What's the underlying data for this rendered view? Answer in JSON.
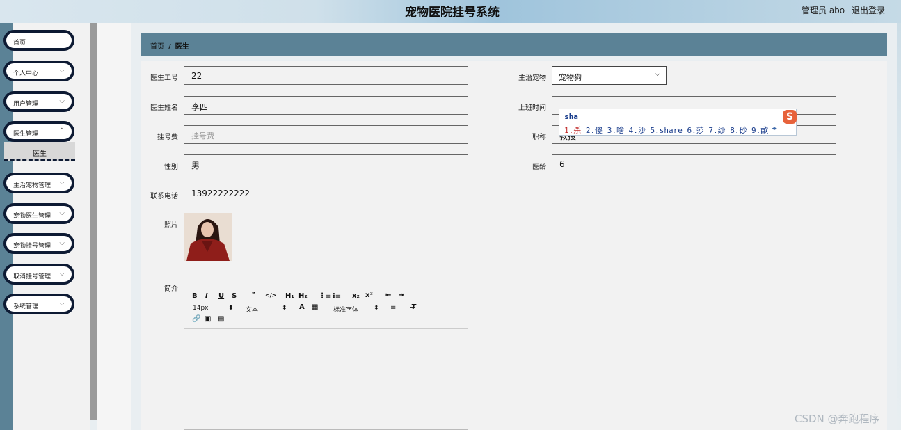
{
  "header": {
    "title": "宠物医院挂号系统",
    "user_label": "管理员 abo",
    "logout_label": "退出登录"
  },
  "sidebar": {
    "items": [
      {
        "label": "首页",
        "has_chevron": false
      },
      {
        "label": "个人中心",
        "has_chevron": true
      },
      {
        "label": "用户管理",
        "has_chevron": true
      },
      {
        "label": "医生管理",
        "has_chevron": true
      },
      {
        "label": "主治宠物管理",
        "has_chevron": true
      },
      {
        "label": "宠物医生管理",
        "has_chevron": true
      },
      {
        "label": "宠物挂号管理",
        "has_chevron": true
      },
      {
        "label": "取消挂号管理",
        "has_chevron": true
      },
      {
        "label": "系统管理",
        "has_chevron": true
      }
    ],
    "submenu_item": "医生"
  },
  "breadcrumb": {
    "home": "首页",
    "separator": "/",
    "current": "医生"
  },
  "form": {
    "doctor_id": {
      "label": "医生工号",
      "value": "22"
    },
    "doctor_name": {
      "label": "医生姓名",
      "value": "李四"
    },
    "fee": {
      "label": "挂号费",
      "value": "",
      "placeholder": "挂号费"
    },
    "gender": {
      "label": "性别",
      "value": "男"
    },
    "phone": {
      "label": "联系电话",
      "value": "13922222222"
    },
    "photo": {
      "label": "照片"
    },
    "intro": {
      "label": "简介"
    },
    "pet": {
      "label": "主治宠物",
      "value": "宠物狗"
    },
    "work_time": {
      "label": "上班时间",
      "value": ""
    },
    "title": {
      "label": "职称",
      "value": "教授"
    },
    "years": {
      "label": "医龄",
      "value": "6"
    }
  },
  "editor": {
    "font_size": "14px",
    "text_style": "文本",
    "font_family": "标准字体"
  },
  "ime": {
    "input": "sha",
    "candidates": "2.傻 3.啥 4.沙 5.share 6.莎 7.纱 8.砂 9.歃",
    "first_candidate": "1.杀",
    "logo": "S"
  },
  "watermark": "CSDN @奔跑程序",
  "colors": {
    "sidebar_edge": "#5b8296",
    "menu_border": "#0d1a33",
    "breadcrumb_bg": "#5b8296"
  }
}
